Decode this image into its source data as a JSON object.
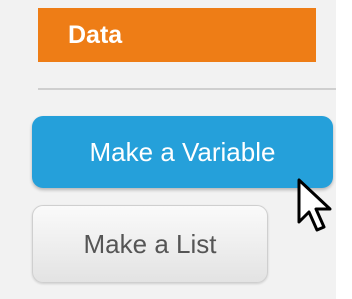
{
  "palette": {
    "category": "Data",
    "category_color": "#ee7d16",
    "buttons": [
      {
        "label": "Make a Variable",
        "state": "hover",
        "color": "#25a0da"
      },
      {
        "label": "Make a List",
        "state": "normal",
        "color": "#eeeeee"
      }
    ]
  },
  "cursor": {
    "icon": "mouse-pointer-icon"
  }
}
